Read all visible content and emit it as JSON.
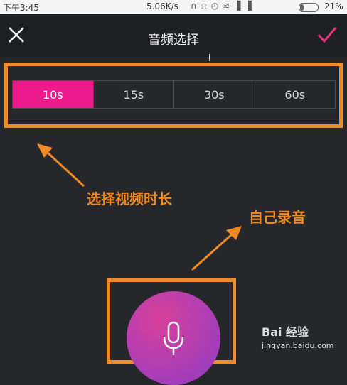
{
  "status_bar": {
    "time": "下午3:45",
    "network_speed": "5.06K/s",
    "battery_percent": "21%",
    "battery_level": 0.21
  },
  "header": {
    "title": "音频选择",
    "close_icon": "close-icon",
    "confirm_icon": "checkmark-icon",
    "confirm_color": "#e6357f"
  },
  "duration_tabs": [
    {
      "label": "10s",
      "selected": true
    },
    {
      "label": "15s",
      "selected": false
    },
    {
      "label": "30s",
      "selected": false
    },
    {
      "label": "60s",
      "selected": false
    }
  ],
  "annotations": {
    "select_duration": "选择视频时长",
    "record_self": "自己录音"
  },
  "record_button": {
    "icon": "microphone-icon"
  },
  "watermark": {
    "logo": "Bai 经验",
    "url": "jingyan.baidu.com"
  },
  "colors": {
    "accent_pink": "#ec1a8d",
    "annotation_orange": "#f08a24",
    "background": "#26272b"
  }
}
